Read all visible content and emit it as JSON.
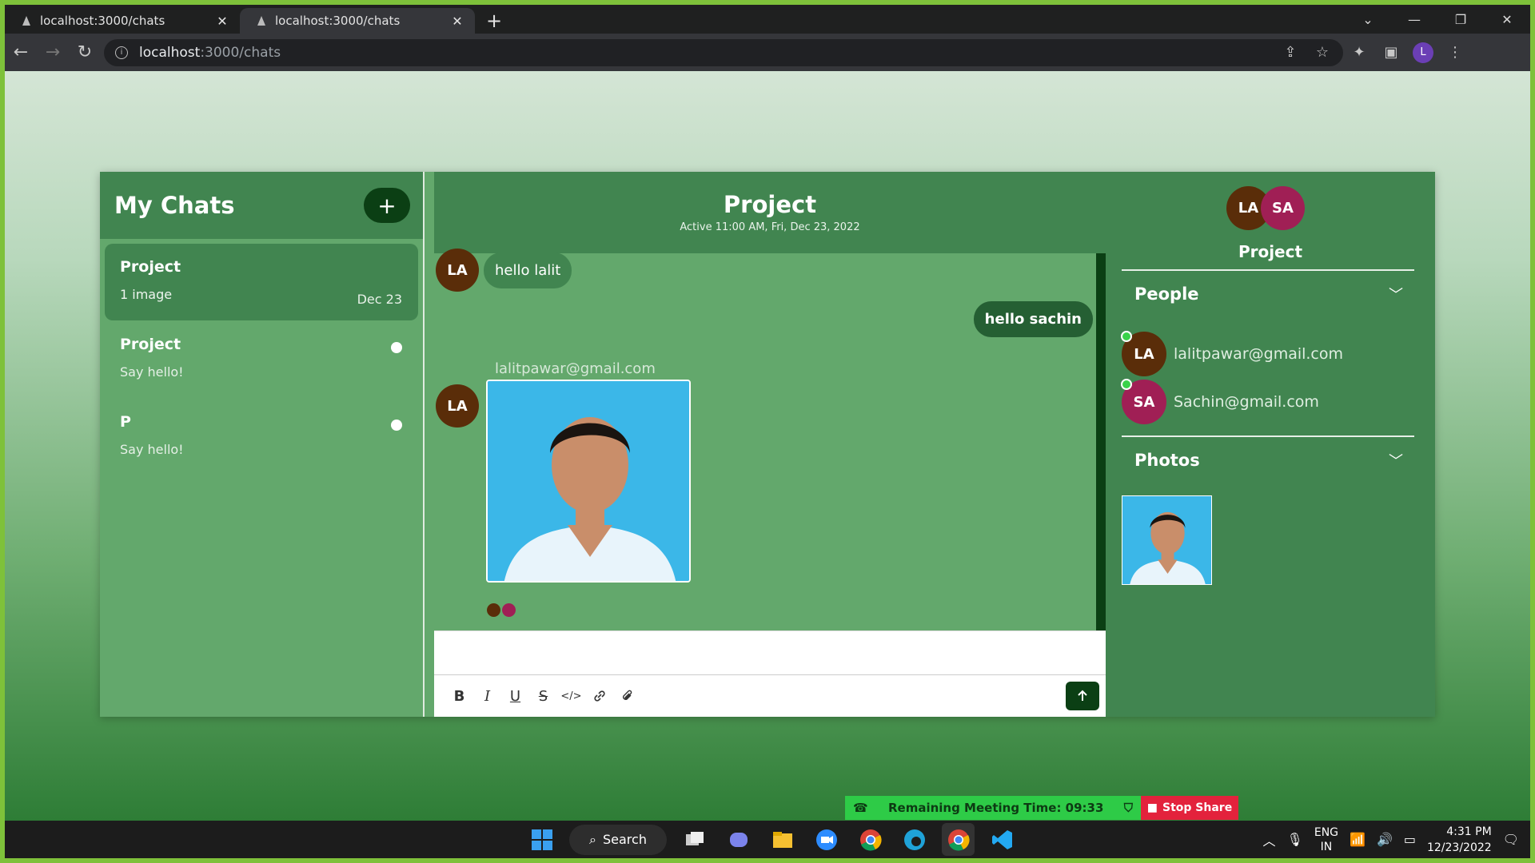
{
  "browser": {
    "tabs": [
      {
        "title": "localhost:3000/chats"
      },
      {
        "title": "localhost:3000/chats"
      }
    ],
    "url_host": "localhost",
    "url_path": ":3000/chats",
    "profile_initial": "L"
  },
  "left": {
    "title": "My Chats",
    "add_label": "+",
    "chats": [
      {
        "name": "Project",
        "preview": "1 image",
        "date": "Dec 23"
      },
      {
        "name": "Project",
        "preview": "Say hello!"
      },
      {
        "name": "P",
        "preview": "Say hello!"
      }
    ]
  },
  "chat": {
    "title": "Project",
    "status": "Active 11:00 AM, Fri, Dec 23, 2022",
    "messages": [
      {
        "avatar": "LA",
        "text": "hello lalit"
      },
      {
        "text": "hello sachin"
      },
      {
        "avatar": "LA",
        "sender": "lalitpawar@gmail.com"
      }
    ],
    "read_colors": [
      "#5a2d09",
      "#a01f55"
    ]
  },
  "composer": {
    "tools": [
      "B",
      "I",
      "U",
      "S",
      "</>",
      "link",
      "attach"
    ],
    "send_icon": "arrow-up-icon"
  },
  "details": {
    "avatars": [
      "LA",
      "SA"
    ],
    "group_name": "Project",
    "people_label": "People",
    "people": [
      {
        "initials": "LA",
        "email": "lalitpawar@gmail.com"
      },
      {
        "initials": "SA",
        "email": "Sachin@gmail.com"
      }
    ],
    "photos_label": "Photos"
  },
  "meeting": {
    "remaining": "Remaining Meeting Time: 09:33",
    "stop": "Stop Share"
  },
  "taskbar": {
    "search": "Search",
    "lang1": "ENG",
    "lang2": "IN",
    "time": "4:31 PM",
    "date": "12/23/2022"
  },
  "colors": {
    "accent_dark": "#0b3f14",
    "panel": "#418550",
    "panel_light": "#63a86c"
  }
}
